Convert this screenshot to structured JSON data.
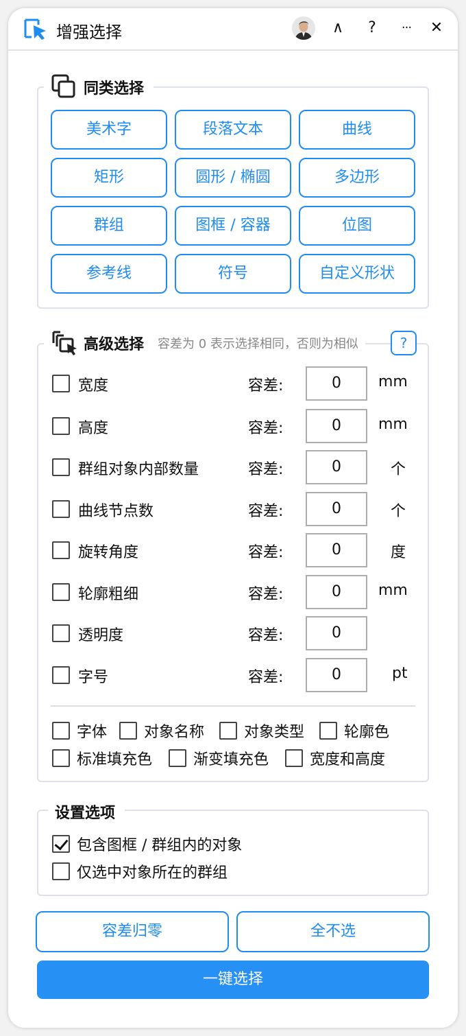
{
  "header": {
    "title": "增强选择",
    "icons": [
      "cursor-select-icon",
      "avatar",
      "chevron-up-icon",
      "help-icon",
      "more-icon",
      "close-icon"
    ],
    "collapse_glyph": "∧",
    "help_glyph": "?",
    "more_glyph": "···",
    "close_glyph": "✕"
  },
  "similar": {
    "title": "同类选择",
    "buttons": [
      "美术字",
      "段落文本",
      "曲线",
      "矩形",
      "圆形 / 椭圆",
      "多边形",
      "群组",
      "图框 / 容器",
      "位图",
      "参考线",
      "符号",
      "自定义形状"
    ]
  },
  "advanced": {
    "title": "高级选择",
    "hint": "容差为 0 表示选择相同，否则为相似",
    "help_label": "?",
    "tolerance_label": "容差:",
    "rows": [
      {
        "label": "宽度",
        "value": "0",
        "unit": "mm",
        "checked": false
      },
      {
        "label": "高度",
        "value": "0",
        "unit": "mm",
        "checked": false
      },
      {
        "label": "群组对象内部数量",
        "value": "0",
        "unit": "个",
        "checked": false
      },
      {
        "label": "曲线节点数",
        "value": "0",
        "unit": "个",
        "checked": false
      },
      {
        "label": "旋转角度",
        "value": "0",
        "unit": "度",
        "checked": false
      },
      {
        "label": "轮廓粗细",
        "value": "0",
        "unit": "mm",
        "checked": false
      },
      {
        "label": "透明度",
        "value": "0",
        "unit": "",
        "checked": false
      },
      {
        "label": "字号",
        "value": "0",
        "unit": "pt",
        "checked": false
      }
    ],
    "extra_checks": [
      "字体",
      "对象名称",
      "对象类型",
      "轮廓色",
      "标准填充色",
      "渐变填充色",
      "宽度和高度"
    ]
  },
  "settings": {
    "title": "设置选项",
    "options": [
      {
        "label": "包含图框 / 群组内的对象",
        "checked": true
      },
      {
        "label": "仅选中对象所在的群组",
        "checked": false
      }
    ]
  },
  "actions": {
    "reset_label": "容差归零",
    "deselect_label": "全不选",
    "select_label": "一键选择"
  },
  "colors": {
    "accent": "#1e8cf0",
    "primary": "#2690f5",
    "border": "#dde2e8"
  }
}
